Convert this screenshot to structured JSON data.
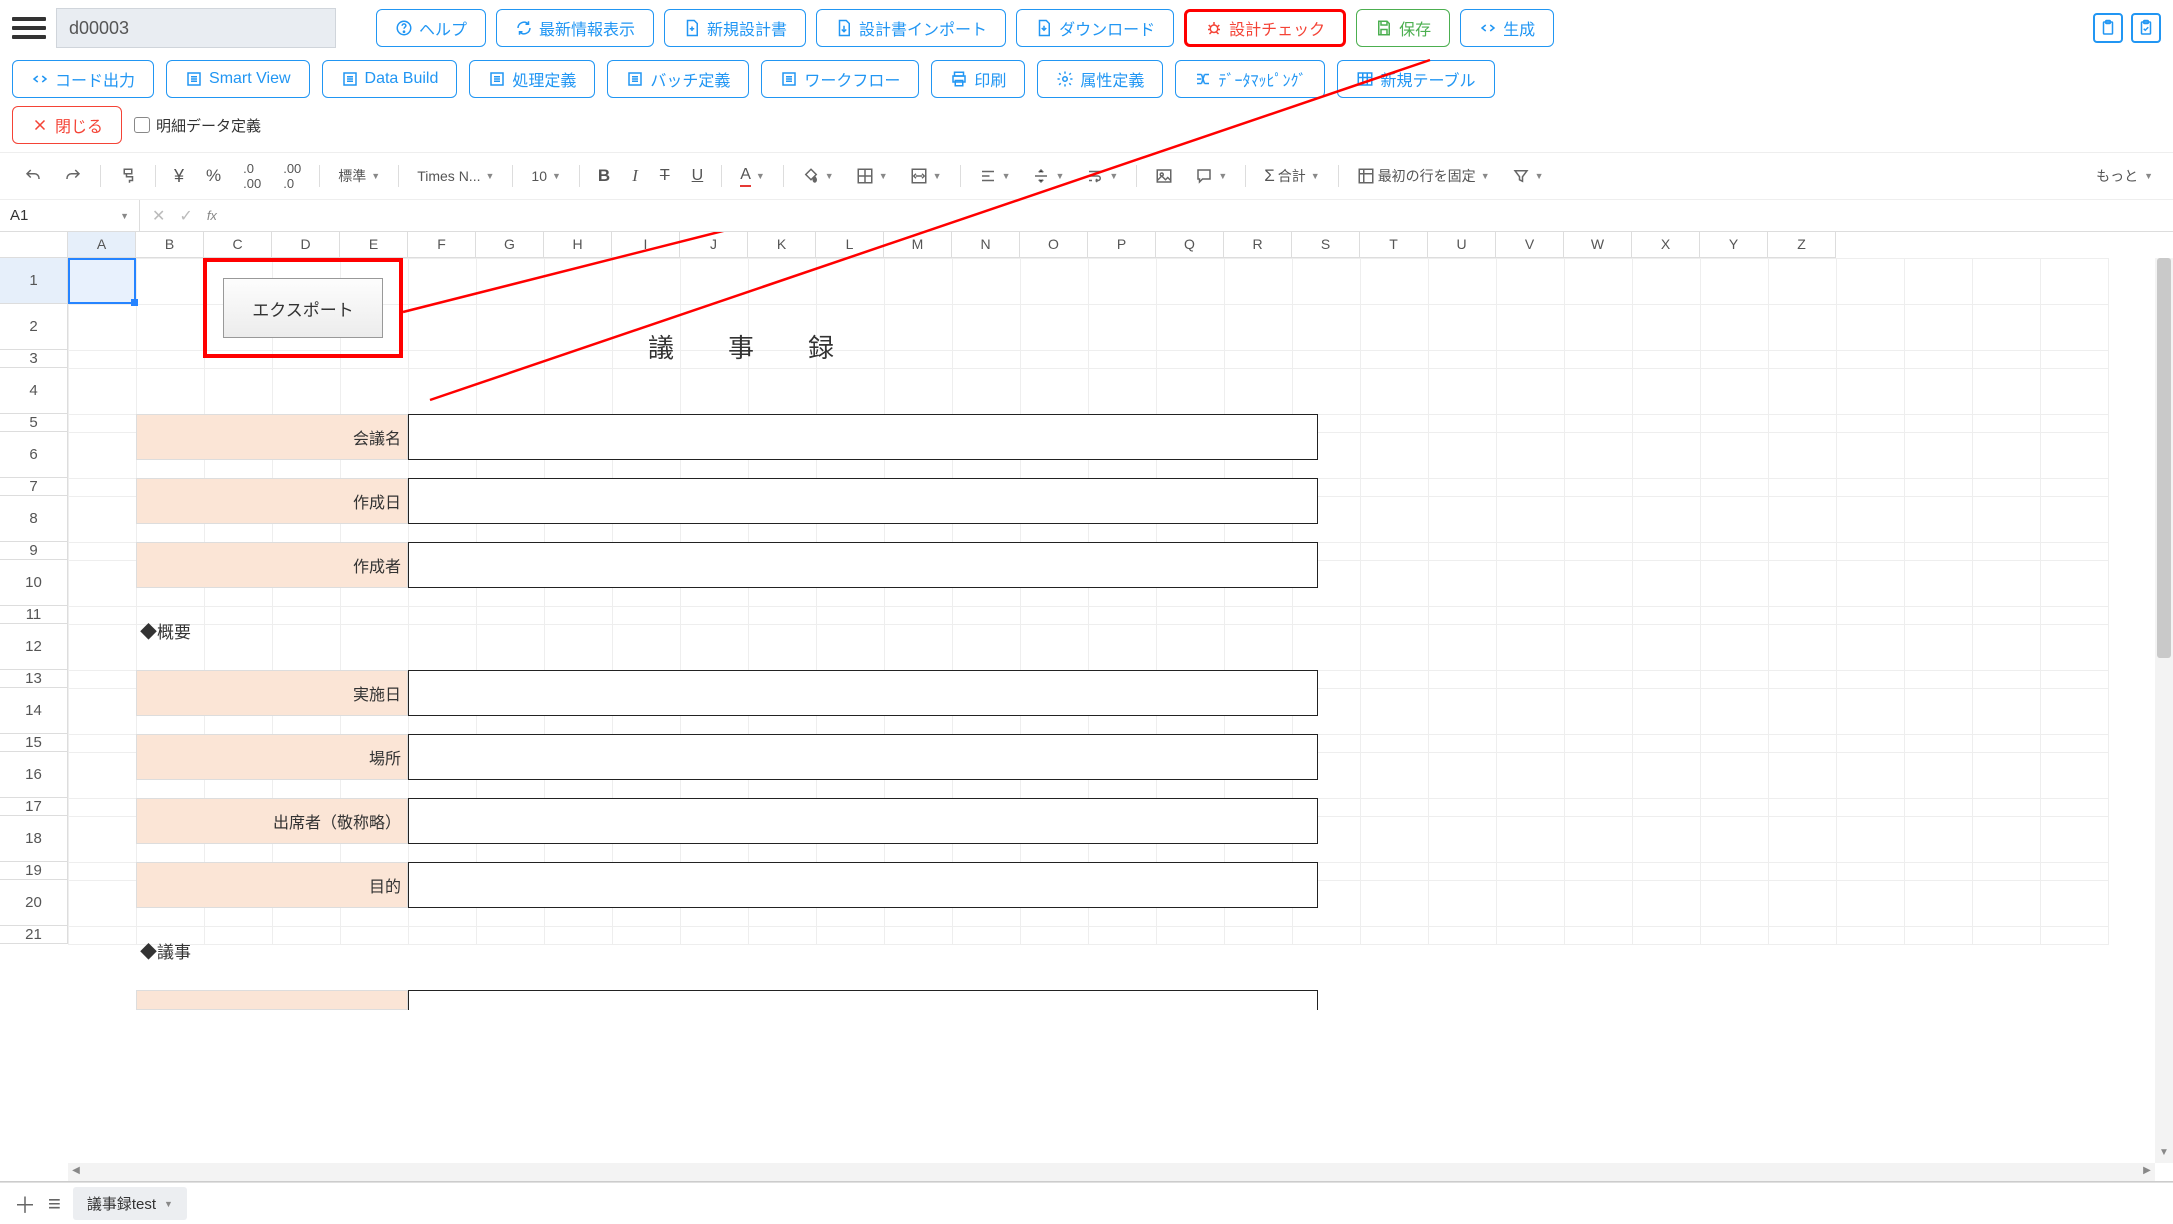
{
  "header": {
    "doc_id": "d00003",
    "buttons": {
      "help": "ヘルプ",
      "refresh": "最新情報表示",
      "new_design": "新規設計書",
      "import_design": "設計書インポート",
      "download": "ダウンロード",
      "design_check": "設計チェック",
      "save": "保存",
      "generate": "生成"
    }
  },
  "row2": {
    "code_out": "コード出力",
    "smart_view": "Smart View",
    "data_build": "Data Build",
    "process_def": "処理定義",
    "batch_def": "バッチ定義",
    "workflow": "ワークフロー",
    "print": "印刷",
    "attr_def": "属性定義",
    "data_mapping": "ﾃﾞｰﾀﾏｯﾋﾟﾝｸﾞ",
    "new_table": "新規テーブル",
    "close": "閉じる",
    "detail_def_chk": "明細データ定義"
  },
  "ss_toolbar": {
    "style": "標準",
    "font": "Times N...",
    "size": "10",
    "sum": "合計",
    "freeze": "最初の行を固定",
    "more": "もっと"
  },
  "formula": {
    "cell": "A1"
  },
  "columns": [
    "A",
    "B",
    "C",
    "D",
    "E",
    "F",
    "G",
    "H",
    "I",
    "J",
    "K",
    "L",
    "M",
    "N",
    "O",
    "P",
    "Q",
    "R",
    "S",
    "T",
    "U",
    "V",
    "W",
    "X",
    "Y",
    "Z"
  ],
  "rows_visible": [
    1,
    2,
    3,
    4,
    5,
    6,
    7,
    8,
    9,
    10,
    11,
    12,
    13,
    14,
    15,
    16,
    17,
    18,
    19,
    20,
    21
  ],
  "form": {
    "title": "議　事　録",
    "export_btn": "エクスポート",
    "labels": {
      "meeting_name": "会議名",
      "created_date": "作成日",
      "created_by": "作成者",
      "overview": "◆概要",
      "impl_date": "実施日",
      "location": "場所",
      "attendees": "出席者（敬称略）",
      "purpose": "目的",
      "agenda": "◆議事"
    }
  },
  "sheet_tab": "議事録test"
}
